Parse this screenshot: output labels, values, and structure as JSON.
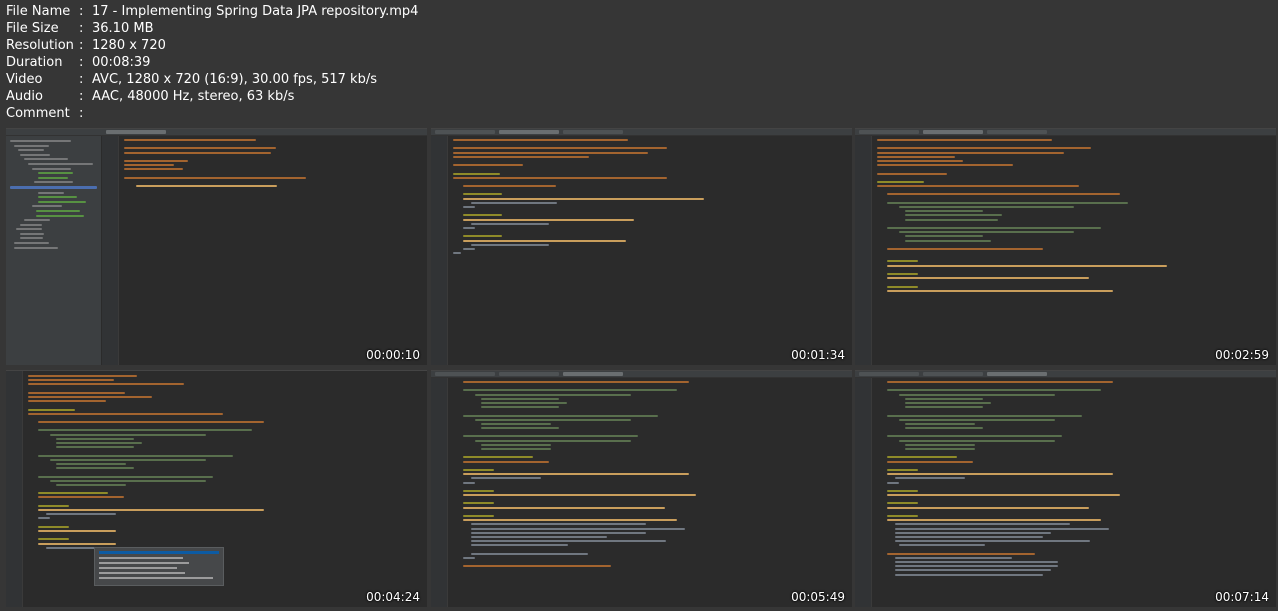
{
  "meta": [
    {
      "key": "File Name",
      "value": "17 - Implementing Spring Data JPA repository.mp4"
    },
    {
      "key": "File Size",
      "value": "36.10 MB"
    },
    {
      "key": "Resolution",
      "value": "1280 x 720"
    },
    {
      "key": "Duration",
      "value": "00:08:39"
    },
    {
      "key": "Video",
      "value": "AVC, 1280 x 720 (16:9), 30.00 fps, 517 kb/s"
    },
    {
      "key": "Audio",
      "value": "AAC, 48000 Hz, stereo, 63 kb/s"
    },
    {
      "key": "Comment",
      "value": ""
    }
  ],
  "separator": ":",
  "thumbnails": [
    {
      "timestamp": "00:00:10"
    },
    {
      "timestamp": "00:01:34"
    },
    {
      "timestamp": "00:02:59"
    },
    {
      "timestamp": "00:04:24"
    },
    {
      "timestamp": "00:05:49"
    },
    {
      "timestamp": "00:07:14"
    }
  ],
  "colors": {
    "background": "#363636",
    "editor": "#2b2b2b",
    "keyword": "#cc7832",
    "string": "#6a8759",
    "annotation": "#bbb529",
    "selection": "#4b6eaf"
  }
}
